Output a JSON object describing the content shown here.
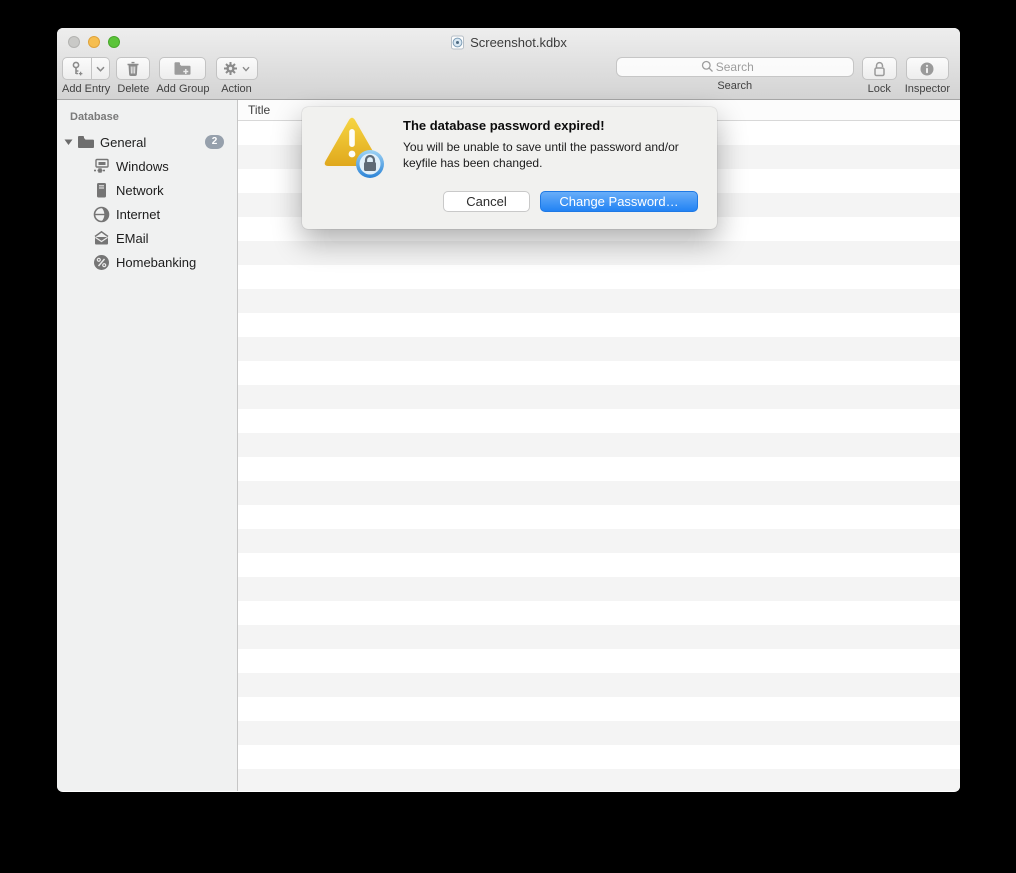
{
  "window": {
    "title": "Screenshot.kdbx"
  },
  "toolbar": {
    "buttons": {
      "add_entry": "Add Entry",
      "delete": "Delete",
      "add_group": "Add Group",
      "action": "Action",
      "lock": "Lock",
      "inspector": "Inspector"
    },
    "search": {
      "label": "Search",
      "placeholder": "Search"
    }
  },
  "sidebar": {
    "section_header": "Database",
    "items": [
      {
        "label": "General",
        "icon": "folder-icon",
        "badge": "2",
        "expanded": true
      },
      {
        "label": "Windows",
        "icon": "windows-icon"
      },
      {
        "label": "Network",
        "icon": "network-icon"
      },
      {
        "label": "Internet",
        "icon": "internet-icon"
      },
      {
        "label": "EMail",
        "icon": "email-icon"
      },
      {
        "label": "Homebanking",
        "icon": "homebanking-icon"
      }
    ]
  },
  "table": {
    "columns": [
      "Title"
    ]
  },
  "dialog": {
    "title": "The database password expired!",
    "message": "You will be unable to save until the password and/or keyfile has been changed.",
    "buttons": {
      "cancel": "Cancel",
      "confirm": "Change Password…"
    }
  },
  "colors": {
    "accent": "#2283f4",
    "warning": "#e9b422",
    "badge": "#96a0ac",
    "stripe": "#f4f4f4"
  }
}
